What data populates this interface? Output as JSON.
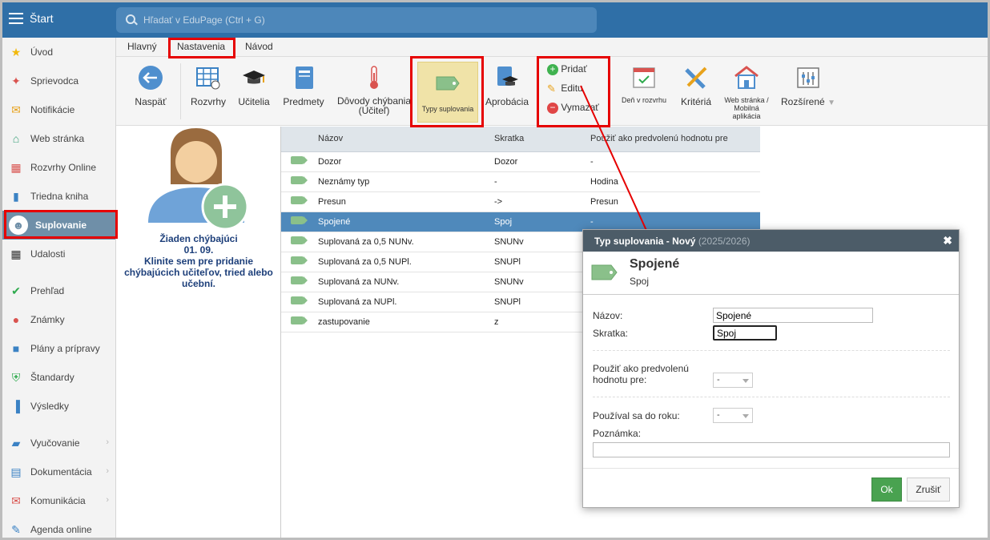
{
  "topbar": {
    "start_label": "Štart",
    "search_placeholder": "Hľadať v EduPage (Ctrl + G)"
  },
  "sidebar": {
    "items": [
      {
        "label": "Úvod",
        "icon": "star-icon"
      },
      {
        "label": "Sprievodca",
        "icon": "magic-wand-icon"
      },
      {
        "label": "Notifikácie",
        "icon": "envelope-icon"
      },
      {
        "label": "Web stránka",
        "icon": "house-icon"
      },
      {
        "label": "Rozvrhy Online",
        "icon": "calendar-grid-icon"
      },
      {
        "label": "Triedna kniha",
        "icon": "book-icon"
      },
      {
        "label": "Suplovanie",
        "icon": "person-icon"
      },
      {
        "label": "Udalosti",
        "icon": "calendar-icon"
      },
      {
        "label": "Prehľad",
        "icon": "check-circle-icon"
      },
      {
        "label": "Známky",
        "icon": "grade-icon"
      },
      {
        "label": "Plány a prípravy",
        "icon": "briefcase-icon"
      },
      {
        "label": "Štandardy",
        "icon": "shield-check-icon"
      },
      {
        "label": "Výsledky",
        "icon": "bar-chart-icon"
      },
      {
        "label": "Vyučovanie",
        "icon": "open-book-icon"
      },
      {
        "label": "Dokumentácia",
        "icon": "document-icon"
      },
      {
        "label": "Komunikácia",
        "icon": "chat-icon"
      },
      {
        "label": "Agenda online",
        "icon": "pencil-icon"
      }
    ],
    "chevron": "›"
  },
  "tabs": {
    "main": "Hlavný",
    "settings": "Nastavenia",
    "guide": "Návod"
  },
  "ribbon": {
    "back": "Naspäť",
    "timetables": "Rozvrhy",
    "teachers": "Učitelia",
    "subjects": "Predmety",
    "absence_reasons": "Dôvody chýbania (Učiteľ)",
    "sub_types": "Typy suplovania",
    "approval": "Aprobácia",
    "add": "Pridať",
    "edit": "Editu",
    "delete": "Vymazať",
    "day_in_timetable": "Deň v rozvrhu",
    "criteria": "Kritériá",
    "web_page": "Web stránka / Mobilná aplikácia",
    "advanced": "Rozšírené"
  },
  "left_panel": {
    "line1": "Žiaden chýbajúci",
    "line2": "01. 09.",
    "line3": "Klinite sem pre pridanie chýbajúcich učiteľov, tried alebo učební."
  },
  "table": {
    "headers": [
      "Názov",
      "Skratka",
      "Použiť ako predvolenú hodnotu pre"
    ],
    "rows": [
      [
        "Dozor",
        "Dozor",
        "-"
      ],
      [
        "Neznámy typ",
        "-",
        "Hodina"
      ],
      [
        "Presun",
        "->",
        "Presun"
      ],
      [
        "Spojené",
        "Spoj",
        "-"
      ],
      [
        "Suplovaná za 0,5 NUNv.",
        "SNUNv",
        ""
      ],
      [
        "Suplovaná za 0,5 NUPl.",
        "SNUPl",
        ""
      ],
      [
        "Suplovaná za NUNv.",
        "SNUNv",
        ""
      ],
      [
        "Suplovaná za NUPl.",
        "SNUPl",
        ""
      ],
      [
        "zastupovanie",
        "z",
        ""
      ]
    ],
    "selected_row": 3
  },
  "dialog": {
    "title": "Typ suplovania - Nový",
    "year": "(2025/2026)",
    "close": "✖",
    "heading": "Spojené",
    "subheading": "Spoj",
    "name_label": "Názov:",
    "name_value": "Spojené",
    "abbr_label": "Skratka:",
    "abbr_value": "Spoj",
    "default_label_1": "Použiť ako predvolenú",
    "default_label_2": "hodnotu pre:",
    "default_value": "-",
    "used_until_label": "Používal sa do roku:",
    "used_until_value": "-",
    "note_label": "Poznámka:",
    "note_value": "",
    "ok": "Ok",
    "cancel": "Zrušiť"
  },
  "colors": {
    "topbar": "#2f6fa7",
    "active_sidebar": "#6f8fa8",
    "selected_row": "#4f89bb",
    "highlight": "#e60000",
    "ok_button": "#49a250"
  }
}
